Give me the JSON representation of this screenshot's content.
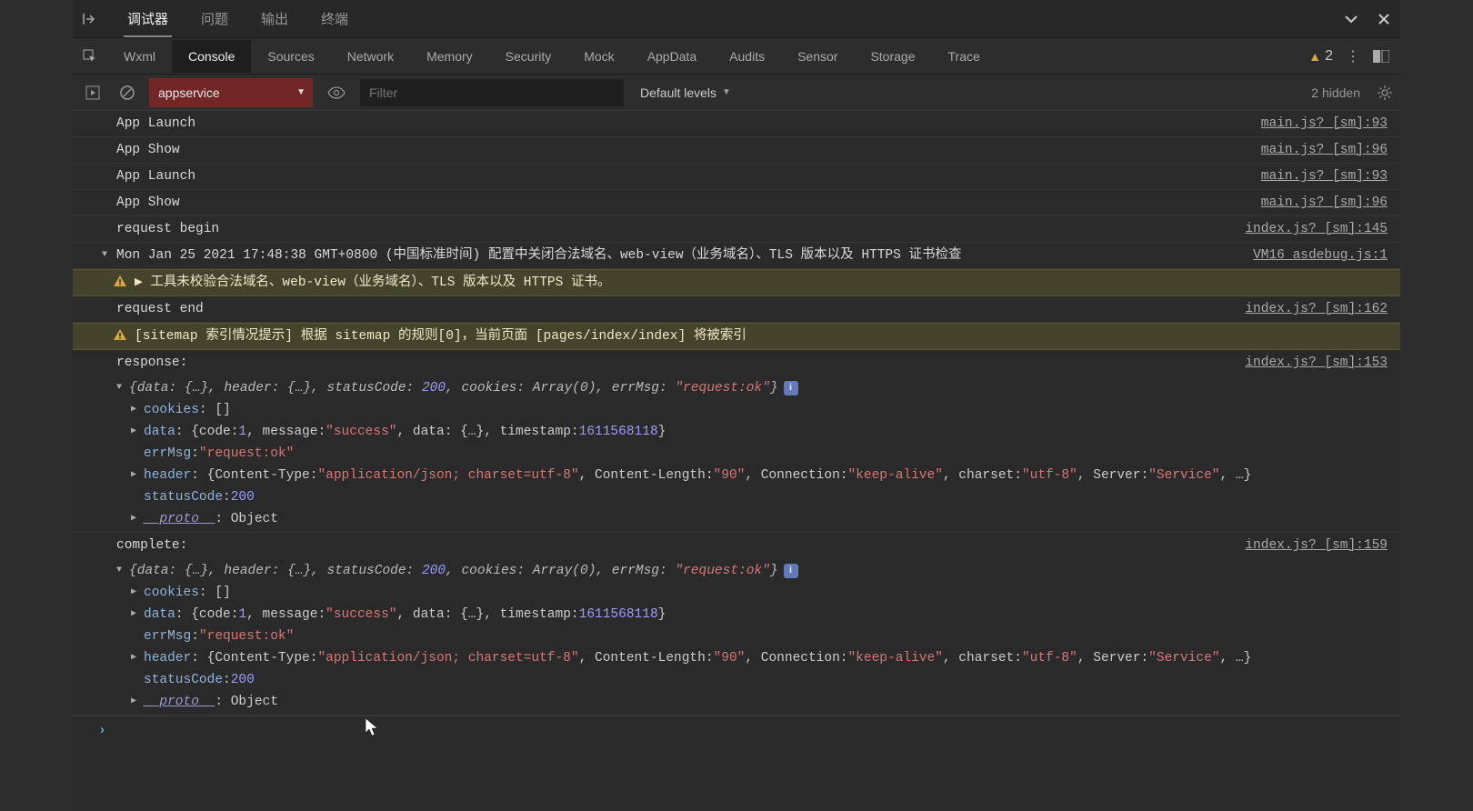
{
  "topTabs": {
    "t0": "调试器",
    "t1": "问题",
    "t2": "输出",
    "t3": "终端"
  },
  "devtoolsTabs": {
    "wxml": "Wxml",
    "console": "Console",
    "sources": "Sources",
    "network": "Network",
    "memory": "Memory",
    "security": "Security",
    "mock": "Mock",
    "appdata": "AppData",
    "audits": "Audits",
    "sensor": "Sensor",
    "storage": "Storage",
    "trace": "Trace"
  },
  "warnCount": "2",
  "toolbar": {
    "context": "appservice",
    "filterPlaceholder": "Filter",
    "levels": "Default levels",
    "hidden": "2 hidden"
  },
  "logs": {
    "l0": {
      "msg": "App Launch",
      "src": "main.js? [sm]:93"
    },
    "l1": {
      "msg": "App Show",
      "src": "main.js? [sm]:96"
    },
    "l2": {
      "msg": "App Launch",
      "src": "main.js? [sm]:93"
    },
    "l3": {
      "msg": "App Show",
      "src": "main.js? [sm]:96"
    },
    "l4": {
      "msg": "request begin",
      "src": "index.js? [sm]:145"
    },
    "l5": {
      "msg": "Mon Jan 25 2021 17:48:38 GMT+0800 (中国标准时间) 配置中关闭合法域名、web-view（业务域名）、TLS 版本以及 HTTPS 证书检查",
      "src": "VM16 asdebug.js:1"
    },
    "l6": {
      "msg": "▶ 工具未校验合法域名、web-view（业务域名）、TLS 版本以及 HTTPS 证书。"
    },
    "l7": {
      "msg": "request end",
      "src": "index.js? [sm]:162"
    },
    "l8": {
      "msg": "[sitemap 索引情况提示] 根据 sitemap 的规则[0]，当前页面 [pages/index/index] 将被索引"
    },
    "l9": {
      "msg": "response:",
      "src": "index.js? [sm]:153"
    },
    "l10": {
      "msg": "complete:",
      "src": "index.js? [sm]:159"
    }
  },
  "obj": {
    "summaryPrefix": "{data: {…}, header: {…}, statusCode: ",
    "statusCode": "200",
    "summaryMid": ", cookies: Array(0), errMsg: ",
    "requestOk": "\"request:ok\"",
    "summaryEnd": "}",
    "cookiesKey": "cookies",
    "cookiesVal": ": []",
    "dataKey": "data",
    "dataOpen": ": {code: ",
    "code1": "1",
    "dataMsg": ", message: ",
    "successStr": "\"success\"",
    "dataMid": ", data: {…}, timestamp: ",
    "timestamp": "1611568118",
    "dataClose": "}",
    "errMsgKey": "errMsg",
    "errMsgColon": ": ",
    "headerKey": "header",
    "headerOpen": ": {Content-Type: ",
    "ctVal": "\"application/json; charset=utf-8\"",
    "clLabel": ", Content-Length: ",
    "clVal": "\"90\"",
    "connLabel": ", Connection: ",
    "connVal": "\"keep-alive\"",
    "charsetLabel": ", charset: ",
    "charsetVal": "\"utf-8\"",
    "serverLabel": ", Server: ",
    "serverVal": "\"Service\"",
    "headerClose": ", …}",
    "statusKey": "statusCode",
    "statusColon": ": ",
    "protoKey": "__proto__",
    "protoVal": ": Object"
  }
}
